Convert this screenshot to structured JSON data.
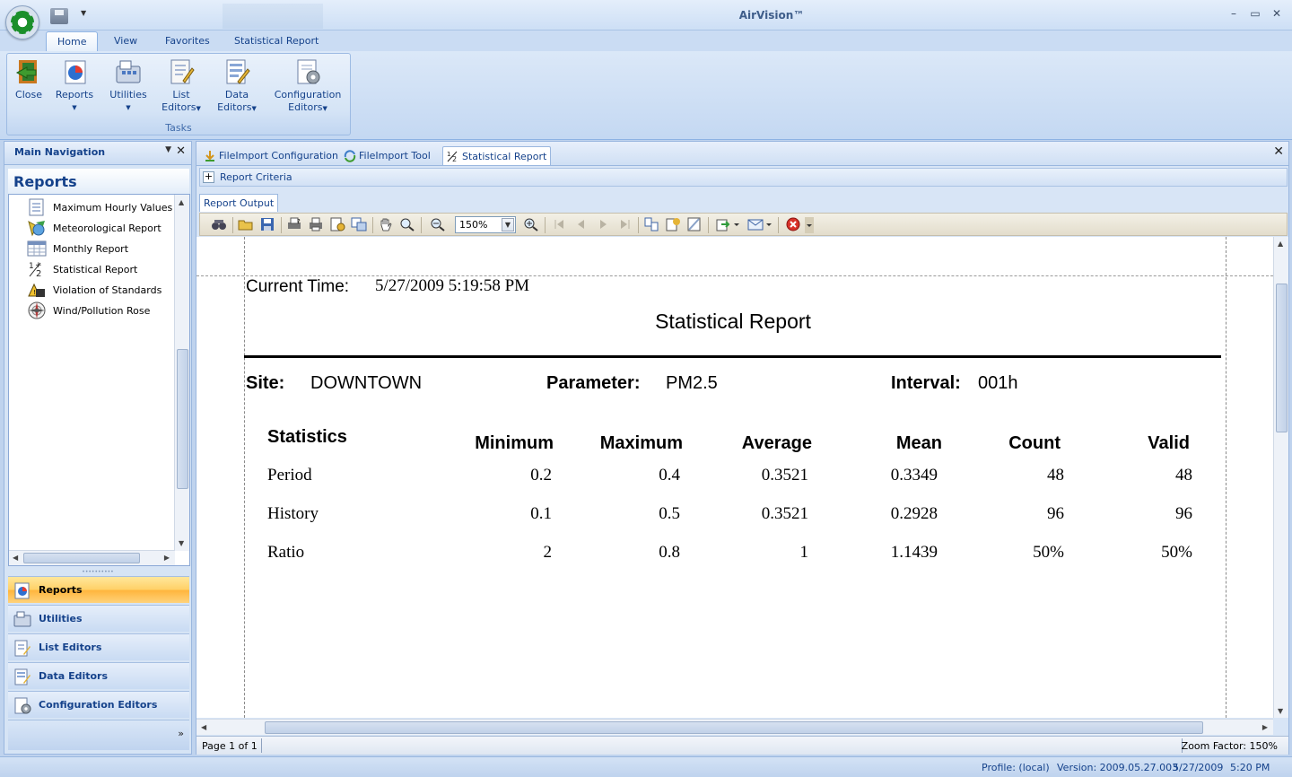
{
  "app": {
    "title": "AirVision™"
  },
  "ribbon": {
    "tabs": [
      "Home",
      "View",
      "Favorites",
      "Statistical Report"
    ],
    "group_label": "Tasks",
    "buttons": [
      {
        "line1": "Close",
        "line2": "",
        "icon": "close-door-icon"
      },
      {
        "line1": "Reports",
        "line2": "",
        "icon": "reports-icon"
      },
      {
        "line1": "Utilities",
        "line2": "",
        "icon": "utilities-icon"
      },
      {
        "line1": "List",
        "line2": "Editors",
        "icon": "list-editors-icon"
      },
      {
        "line1": "Data",
        "line2": "Editors",
        "icon": "data-editors-icon"
      },
      {
        "line1": "Configuration",
        "line2": "Editors",
        "icon": "configuration-editors-icon"
      }
    ]
  },
  "nav": {
    "header": "Main Navigation",
    "title": "Reports",
    "tree_items": [
      "Maximum Hourly Values",
      "Meteorological Report",
      "Monthly Report",
      "Statistical Report",
      "Violation of Standards",
      "Wind/Pollution Rose"
    ],
    "buttons": [
      "Reports",
      "Utilities",
      "List Editors",
      "Data Editors",
      "Configuration Editors"
    ]
  },
  "doc": {
    "tabs": [
      "FileImport Configuration",
      "FileImport Tool",
      "Statistical Report"
    ],
    "criteria_label": "Report Criteria",
    "output_tab": "Report Output",
    "zoom": "150%",
    "status_page": "Page 1 of 1",
    "status_zoom": "Zoom Factor: 150%"
  },
  "report": {
    "current_time_label": "Current Time:",
    "current_time": "5/27/2009 5:19:58 PM",
    "title": "Statistical Report",
    "site_label": "Site:",
    "site": "DOWNTOWN",
    "parameter_label": "Parameter:",
    "parameter": "PM2.5",
    "interval_label": "Interval:",
    "interval": "001h",
    "columns": [
      "Statistics",
      "Minimum",
      "Maximum",
      "Average",
      "Mean",
      "Count",
      "Valid"
    ],
    "rows": [
      [
        "Period",
        "0.2",
        "0.4",
        "0.3521",
        "0.3349",
        "48",
        "48"
      ],
      [
        "History",
        "0.1",
        "0.5",
        "0.3521",
        "0.2928",
        "96",
        "96"
      ],
      [
        "Ratio",
        "2",
        "0.8",
        "1",
        "1.1439",
        "50%",
        "50%"
      ]
    ]
  },
  "statusbar": {
    "profile": "Profile: (local)",
    "version": "Version: 2009.05.27.003",
    "date": "5/27/2009",
    "time": "5:20 PM"
  }
}
